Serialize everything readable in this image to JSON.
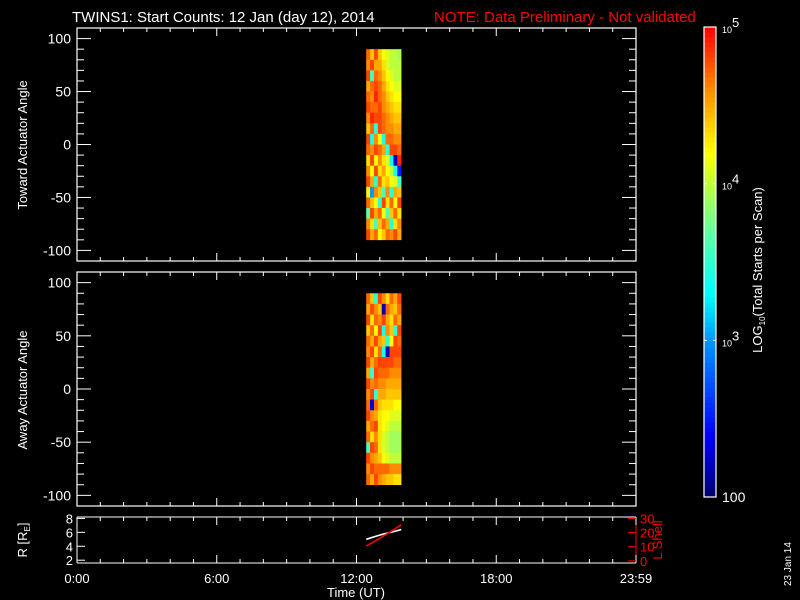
{
  "title": "TWINS1: Start Counts: 12 Jan (day  12), 2014",
  "note": "NOTE: Data Preliminary - Not validated",
  "date_stamp": "23 Jan 14",
  "colors": {
    "background": "#000000",
    "axes": "#ffffff",
    "note": "#ff0000",
    "r_line": "#ffffff",
    "l_line": "#ff0000"
  },
  "colorbar": {
    "label_main": "LOG",
    "label_sub": "10",
    "label_rest": "(Total Starts per Scan)",
    "scale": "log",
    "range": [
      100,
      100000
    ],
    "ticks": [
      {
        "value": 100000,
        "base": "10",
        "exp": "5"
      },
      {
        "value": 10000,
        "base": "10",
        "exp": "4"
      },
      {
        "value": 1000,
        "base": "10",
        "exp": "3"
      },
      {
        "value": 100,
        "base": "100",
        "exp": ""
      }
    ],
    "colormap": "rainbow (dark blue to red)"
  },
  "chart_data": [
    {
      "type": "heatmap",
      "ylabel": "Toward Actuator Angle",
      "ylim": [
        -110,
        110
      ],
      "yticks": [
        100,
        50,
        0,
        -50,
        -100
      ],
      "xlim_hours": [
        0,
        24
      ],
      "time_bins": [
        "12:25",
        "12:35",
        "12:45",
        "12:55",
        "13:05",
        "13:15",
        "13:25",
        "13:35",
        "13:45",
        "13:55"
      ],
      "angle_bins": [
        90,
        80,
        70,
        60,
        50,
        40,
        30,
        20,
        10,
        0,
        -10,
        -20,
        -30,
        -40,
        -50,
        -60,
        -70,
        -80,
        -90
      ],
      "log10_counts": [
        [
          4.7,
          4.4,
          4.8,
          4.4,
          4.2,
          4.1,
          4.0,
          4.0,
          3.9
        ],
        [
          4.6,
          4.8,
          4.5,
          4.5,
          4.3,
          4.1,
          4.0,
          4.0,
          4.0
        ],
        [
          4.8,
          3.6,
          4.7,
          4.6,
          4.4,
          4.2,
          4.1,
          4.0,
          4.0
        ],
        [
          4.5,
          4.7,
          4.8,
          4.7,
          4.5,
          4.3,
          4.2,
          4.1,
          4.1
        ],
        [
          4.7,
          4.6,
          4.9,
          4.7,
          4.6,
          4.4,
          4.3,
          4.2,
          4.2
        ],
        [
          4.8,
          4.7,
          4.7,
          4.8,
          4.6,
          4.5,
          4.4,
          4.3,
          4.3
        ],
        [
          4.6,
          4.9,
          4.8,
          4.8,
          4.7,
          4.6,
          4.5,
          4.4,
          4.4
        ],
        [
          4.4,
          4.7,
          3.5,
          4.8,
          4.7,
          4.6,
          4.6,
          4.5,
          4.5
        ],
        [
          4.8,
          3.4,
          4.6,
          4.2,
          3.4,
          4.7,
          4.7,
          4.6,
          4.6
        ],
        [
          4.7,
          4.6,
          4.8,
          4.7,
          4.5,
          3.5,
          4.8,
          4.8,
          4.7
        ],
        [
          4.3,
          4.8,
          4.2,
          4.6,
          4.3,
          4.1,
          3.3,
          2.2,
          4.9
        ],
        [
          4.6,
          4.2,
          4.8,
          4.3,
          4.5,
          4.2,
          4.0,
          3.4,
          2.5
        ],
        [
          4.8,
          4.5,
          3.5,
          4.7,
          4.3,
          4.4,
          4.2,
          4.1,
          3.6
        ],
        [
          4.2,
          3.0,
          4.6,
          4.4,
          3.6,
          4.6,
          3.5,
          4.5,
          4.4
        ],
        [
          4.7,
          4.4,
          4.2,
          3.5,
          4.8,
          4.3,
          4.7,
          4.2,
          4.8
        ],
        [
          3.7,
          4.8,
          4.5,
          4.7,
          4.2,
          3.6,
          4.4,
          4.7,
          4.3
        ],
        [
          4.6,
          4.3,
          3.6,
          4.4,
          4.7,
          4.5,
          3.5,
          4.3,
          4.6
        ],
        [
          4.8,
          4.5,
          4.7,
          4.2,
          4.4,
          4.7,
          4.6,
          4.8,
          4.5
        ]
      ]
    },
    {
      "type": "heatmap",
      "ylabel": "Away Actuator Angle",
      "ylim": [
        -110,
        110
      ],
      "yticks": [
        100,
        50,
        0,
        -50,
        -100
      ],
      "xlim_hours": [
        0,
        24
      ],
      "time_bins": [
        "12:25",
        "12:35",
        "12:45",
        "12:55",
        "13:05",
        "13:15",
        "13:25",
        "13:35",
        "13:45",
        "13:55"
      ],
      "angle_bins": [
        90,
        80,
        70,
        60,
        50,
        40,
        30,
        20,
        10,
        0,
        -10,
        -20,
        -30,
        -40,
        -50,
        -60,
        -70,
        -80,
        -90
      ],
      "log10_counts": [
        [
          4.7,
          4.4,
          3.5,
          4.8,
          4.6,
          4.3,
          4.7,
          4.5,
          4.8
        ],
        [
          4.5,
          4.8,
          4.6,
          4.4,
          2.2,
          4.7,
          4.5,
          4.4,
          4.7
        ],
        [
          4.8,
          4.3,
          4.7,
          4.6,
          4.8,
          4.5,
          4.3,
          4.7,
          4.5
        ],
        [
          4.4,
          4.7,
          4.2,
          4.8,
          3.4,
          4.6,
          4.4,
          3.5,
          4.8
        ],
        [
          4.7,
          4.5,
          4.8,
          4.5,
          4.4,
          3.5,
          4.2,
          4.8,
          4.7
        ],
        [
          4.6,
          4.8,
          4.3,
          4.7,
          3.4,
          2.2,
          4.8,
          4.8,
          4.8
        ],
        [
          4.8,
          4.5,
          4.7,
          4.8,
          4.8,
          4.8,
          4.8,
          4.7,
          4.7
        ],
        [
          4.5,
          3.5,
          4.8,
          4.7,
          4.7,
          4.7,
          4.6,
          4.6,
          4.6
        ],
        [
          4.8,
          4.6,
          4.7,
          4.6,
          4.6,
          4.5,
          4.5,
          4.5,
          4.5
        ],
        [
          4.6,
          4.8,
          3.5,
          4.5,
          4.5,
          4.4,
          4.4,
          4.4,
          4.4
        ],
        [
          4.7,
          2.3,
          4.7,
          4.4,
          4.3,
          4.3,
          4.3,
          4.2,
          4.2
        ],
        [
          4.8,
          4.6,
          4.5,
          4.3,
          4.2,
          4.2,
          4.1,
          4.1,
          4.1
        ],
        [
          4.5,
          4.7,
          4.8,
          4.3,
          4.2,
          4.1,
          4.0,
          4.0,
          4.0
        ],
        [
          4.7,
          4.3,
          4.6,
          4.3,
          4.1,
          4.0,
          3.9,
          3.9,
          3.9
        ],
        [
          3.6,
          4.8,
          4.7,
          4.3,
          4.1,
          4.0,
          3.9,
          3.9,
          3.9
        ],
        [
          4.8,
          4.6,
          4.5,
          4.4,
          4.2,
          4.1,
          4.0,
          4.0,
          4.0
        ],
        [
          4.6,
          4.8,
          4.7,
          4.7,
          4.7,
          4.7,
          4.6,
          4.6,
          4.6
        ],
        [
          4.7,
          4.5,
          4.8,
          4.6,
          4.5,
          4.4,
          4.4,
          4.3,
          4.3
        ]
      ]
    },
    {
      "type": "line",
      "xlabel": "Time (UT)",
      "xticks": [
        "0:00",
        "6:00",
        "12:00",
        "18:00",
        "23:59"
      ],
      "xtick_hours": [
        0,
        6,
        12,
        18,
        24
      ],
      "ylabel_left": "R [R",
      "ylabel_left_sub": "E",
      "ylabel_left_end": "]",
      "ylabel_right": "L Shell",
      "ylim_left": [
        1.6,
        8.2
      ],
      "yticks_left": [
        2,
        4,
        6,
        8
      ],
      "ylim_right": [
        -1.5,
        31
      ],
      "yticks_right": [
        0,
        10,
        20,
        30
      ],
      "series": [
        {
          "axis": "left",
          "color": "#ffffff",
          "x_hours": [
            12.42,
            12.8,
            13.2,
            13.6,
            13.92
          ],
          "y": [
            5.0,
            5.4,
            5.8,
            6.1,
            6.4
          ]
        },
        {
          "axis": "right",
          "color": "#ff0000",
          "x_hours": [
            12.42,
            12.8,
            13.2,
            13.6,
            13.92
          ],
          "y": [
            10.5,
            14.0,
            18.0,
            22.0,
            25.5
          ]
        }
      ]
    }
  ]
}
